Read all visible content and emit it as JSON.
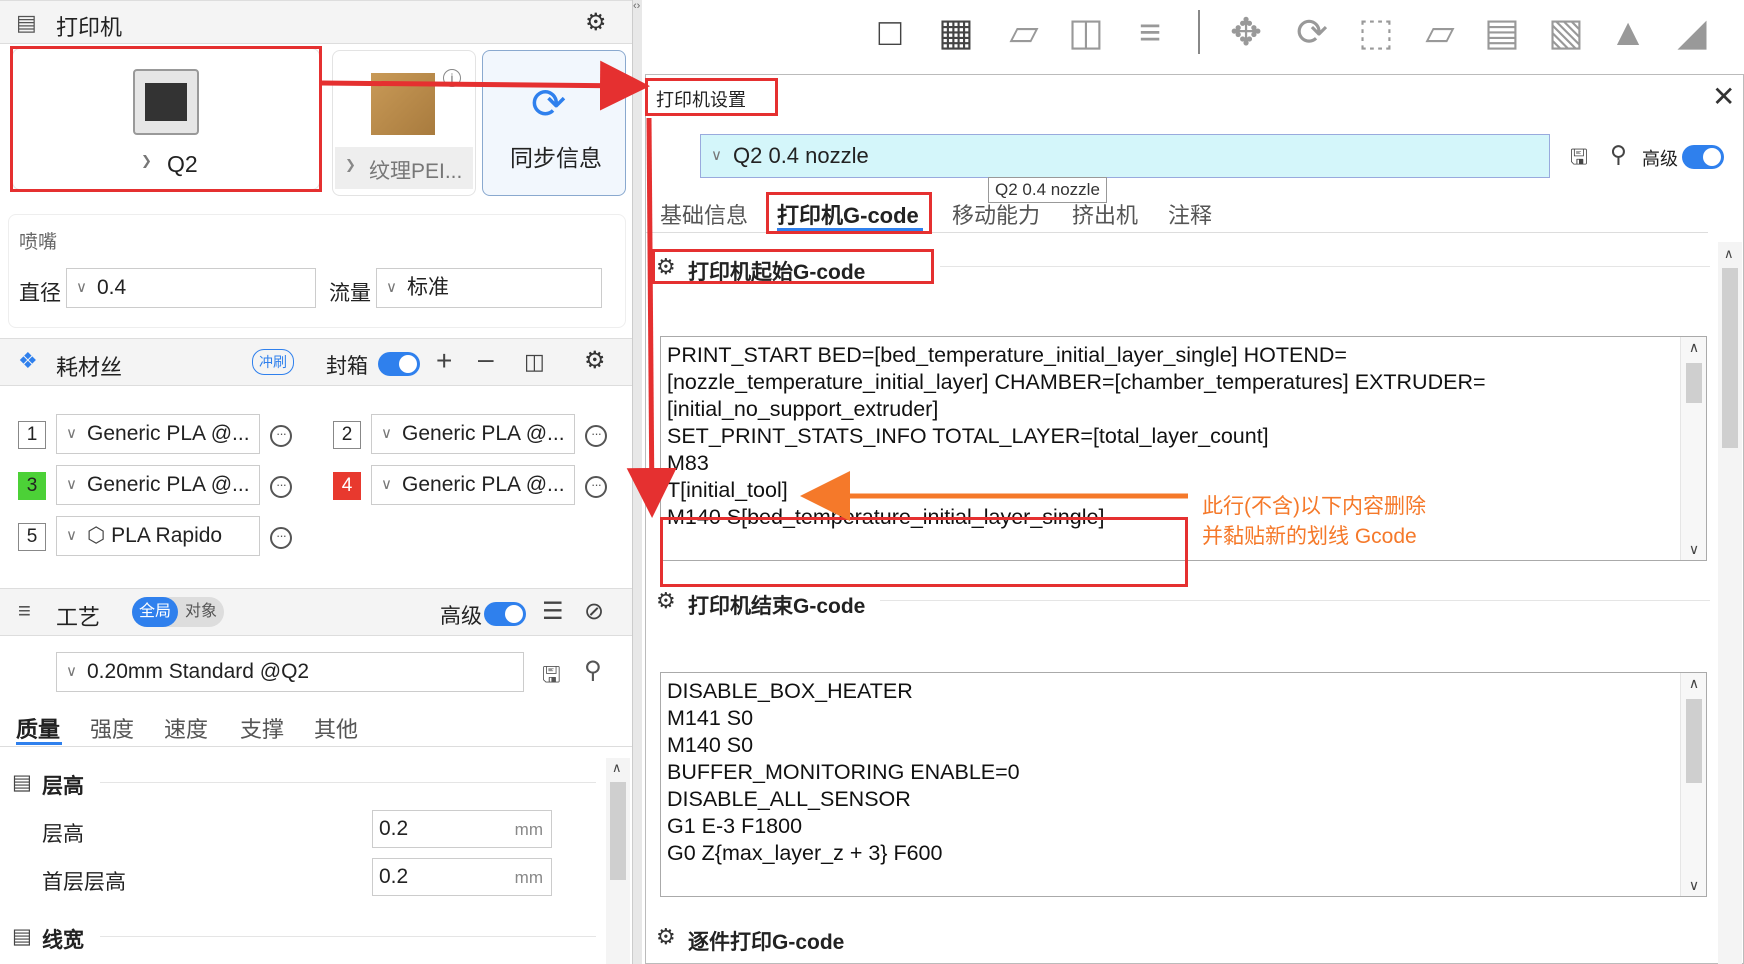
{
  "printer_panel": {
    "title": "打印机",
    "printer_name": "Q2",
    "plate_name": "纹理PEI...",
    "sync_label": "同步信息",
    "nozzle_section": "喷嘴",
    "diameter_label": "直径",
    "diameter_value": "0.4",
    "flow_label": "流量",
    "flow_value": "标准"
  },
  "filament_panel": {
    "title": "耗材丝",
    "flush_label": "冲刷",
    "enclosure_label": "封箱",
    "slots": [
      {
        "num": "1",
        "name": "Generic PLA @...",
        "color": "#ffffff"
      },
      {
        "num": "2",
        "name": "Generic PLA @...",
        "color": "#ffffff"
      },
      {
        "num": "3",
        "name": "Generic PLA @...",
        "color": "#4cd137"
      },
      {
        "num": "4",
        "name": "Generic PLA @...",
        "color": "#e8392e"
      },
      {
        "num": "5",
        "name": "PLA Rapido",
        "color": "#ffffff"
      }
    ]
  },
  "process_panel": {
    "title": "工艺",
    "scope_global": "全局",
    "scope_object": "对象",
    "advanced_label": "高级",
    "preset": "0.20mm Standard @Q2",
    "tabs": [
      "质量",
      "强度",
      "速度",
      "支撑",
      "其他"
    ],
    "group_layer": "层高",
    "layer_height_label": "层高",
    "layer_height_value": "0.2",
    "first_layer_label": "首层层高",
    "first_layer_value": "0.2",
    "unit": "mm",
    "group_width": "线宽"
  },
  "dialog": {
    "title": "打印机设置",
    "preset": "Q2 0.4 nozzle",
    "tooltip": "Q2 0.4 nozzle",
    "advanced_label": "高级",
    "tabs": [
      "基础信息",
      "打印机G-code",
      "移动能力",
      "挤出机",
      "注释"
    ],
    "start_gcode_title": "打印机起始G-code",
    "start_gcode": [
      "PRINT_START BED=[bed_temperature_initial_layer_single] HOTEND=",
      "[nozzle_temperature_initial_layer] CHAMBER=[chamber_temperatures] EXTRUDER=",
      "[initial_no_support_extruder]",
      "SET_PRINT_STATS_INFO TOTAL_LAYER=[total_layer_count]",
      "M83",
      "T[initial_tool]",
      "M140 S[bed_temperature_initial_layer_single]"
    ],
    "end_gcode_title": "打印机结束G-code",
    "end_gcode": [
      "DISABLE_BOX_HEATER",
      "M141 S0",
      "M140 S0",
      "BUFFER_MONITORING ENABLE=0",
      "DISABLE_ALL_SENSOR",
      "G1 E-3 F1800",
      "G0 Z{max_layer_z + 3} F600"
    ],
    "object_gcode_title": "逐件打印G-code"
  },
  "annotation": {
    "line1": "此行(不含)以下内容删除",
    "line2": "并黏贴新的划线 Gcode"
  },
  "colors": {
    "accent": "#2f80ed",
    "annotation_red": "#e53030",
    "annotation_orange": "#f5792a",
    "preset_bg": "#d4f6fa"
  }
}
